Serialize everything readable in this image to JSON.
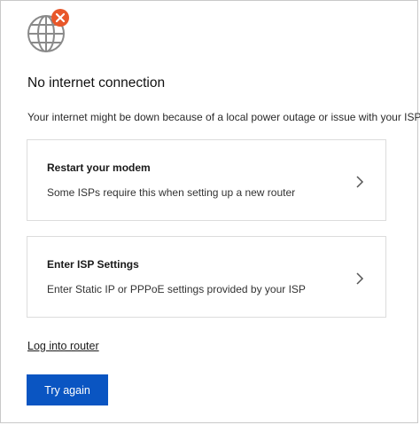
{
  "header": {
    "title": "No internet connection",
    "message": "Your internet might be down because of a local power outage or issue with your ISP."
  },
  "status_icon": {
    "icon": "globe-icon",
    "badge_icon": "error-x-icon",
    "badge_color": "#e8572a"
  },
  "options": [
    {
      "title": "Restart your modem",
      "description": "Some ISPs require this when setting up a new router",
      "icon": "chevron-right-icon"
    },
    {
      "title": "Enter ISP Settings",
      "description": "Enter Static IP or PPPoE settings provided by your ISP",
      "icon": "chevron-right-icon"
    }
  ],
  "links": {
    "login_label": "Log into router"
  },
  "actions": {
    "retry_label": "Try again",
    "accent_color": "#0a55c2"
  }
}
